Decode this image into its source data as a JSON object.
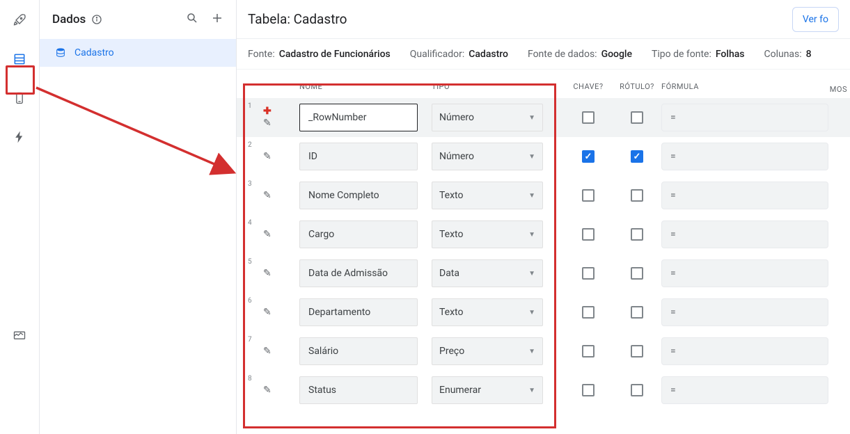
{
  "rail": {
    "icons": [
      "rocket",
      "data",
      "phone",
      "bolt",
      "monitor"
    ]
  },
  "leftpanel": {
    "title": "Dados",
    "item_label": "Cadastro"
  },
  "header": {
    "title_prefix": "Tabela: ",
    "title_name": "Cadastro",
    "view_button": "Ver fo"
  },
  "meta": {
    "fonte_k": "Fonte:",
    "fonte_v": "Cadastro de Funcionários",
    "qualificador_k": "Qualificador:",
    "qualificador_v": "Cadastro",
    "fontedados_k": "Fonte de dados:",
    "fontedados_v": "Google",
    "tipofonte_k": "Tipo de fonte:",
    "tipofonte_v": "Folhas",
    "colunas_k": "Colunas:",
    "colunas_v": "8"
  },
  "columns": {
    "nome": "NOME",
    "tipo": "TIPO",
    "chave": "CHAVE?",
    "rotulo": "RÓTULO?",
    "formula": "FÓRMULA",
    "mostrar": "MOS"
  },
  "rows": [
    {
      "n": "1",
      "name": "_RowNumber",
      "type": "Número",
      "chave": false,
      "rotulo": false,
      "formula": "="
    },
    {
      "n": "2",
      "name": "ID",
      "type": "Número",
      "chave": true,
      "rotulo": true,
      "formula": "="
    },
    {
      "n": "3",
      "name": "Nome Completo",
      "type": "Texto",
      "chave": false,
      "rotulo": false,
      "formula": "="
    },
    {
      "n": "4",
      "name": "Cargo",
      "type": "Texto",
      "chave": false,
      "rotulo": false,
      "formula": "="
    },
    {
      "n": "5",
      "name": "Data de Admissão",
      "type": "Data",
      "chave": false,
      "rotulo": false,
      "formula": "="
    },
    {
      "n": "6",
      "name": "Departamento",
      "type": "Texto",
      "chave": false,
      "rotulo": false,
      "formula": "="
    },
    {
      "n": "7",
      "name": "Salário",
      "type": "Preço",
      "chave": false,
      "rotulo": false,
      "formula": "="
    },
    {
      "n": "8",
      "name": "Status",
      "type": "Enumerar",
      "chave": false,
      "rotulo": false,
      "formula": "="
    }
  ]
}
